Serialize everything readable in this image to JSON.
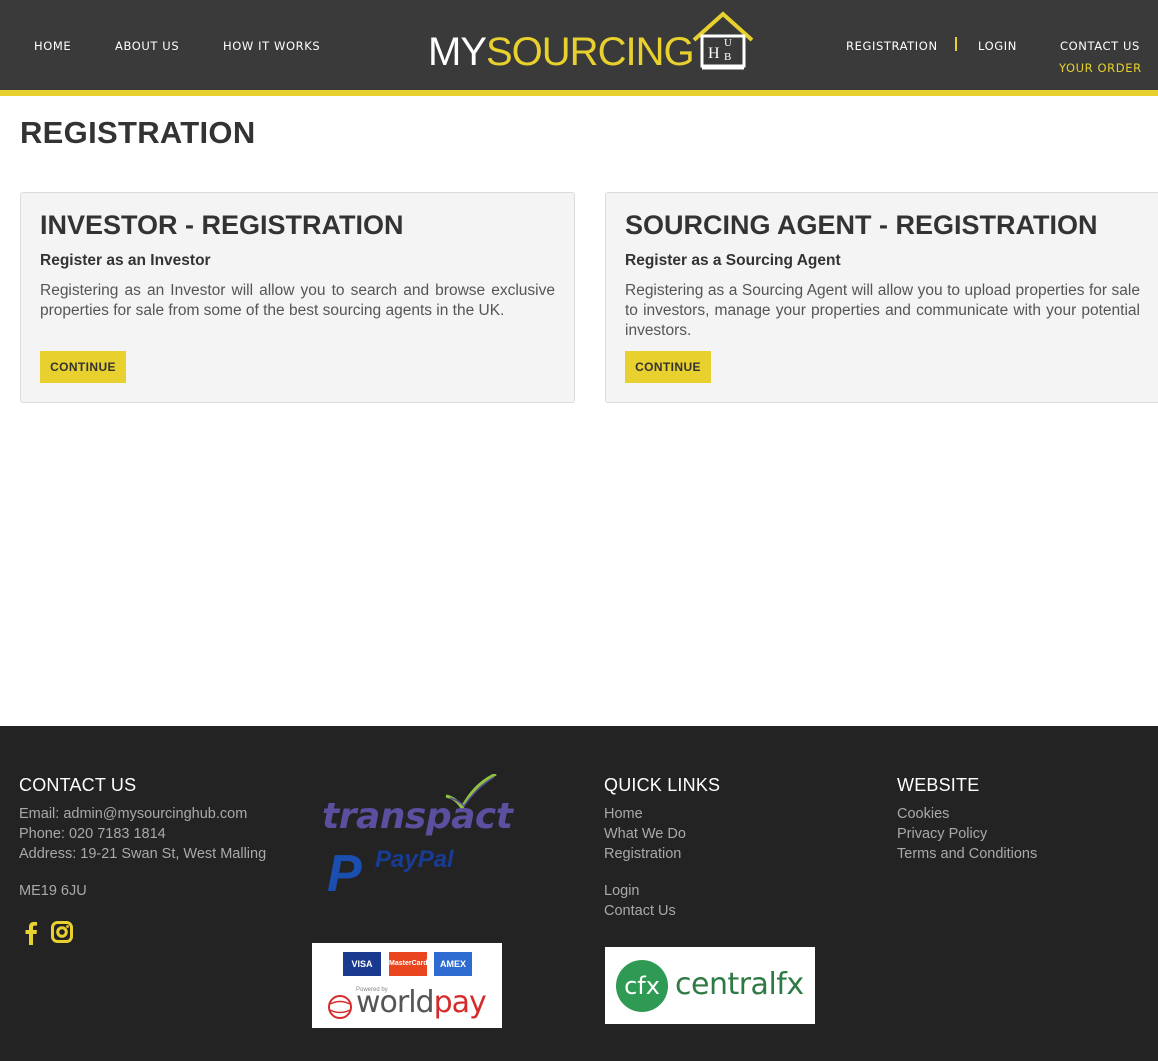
{
  "header": {
    "nav_left": [
      "HOME",
      "ABOUT US",
      "HOW IT WORKS"
    ],
    "nav_right": [
      "REGISTRATION",
      "LOGIN",
      "CONTACT US"
    ],
    "your_order": "YOUR ORDER",
    "logo": {
      "my": "MY",
      "sourcing": "SOURCING",
      "hub": "HUB"
    },
    "accent_color": "#e8d02e",
    "bg_color": "#393a39"
  },
  "page": {
    "title": "REGISTRATION"
  },
  "cards": [
    {
      "title": "INVESTOR - REGISTRATION",
      "subtitle": "Register as an Investor",
      "text": "Registering as an Investor will allow you to search and browse exclusive properties for sale from some of the best sourcing agents in the UK.",
      "button": "CONTINUE"
    },
    {
      "title": "SOURCING AGENT - REGISTRATION",
      "subtitle": "Register as a Sourcing Agent",
      "text": "Registering as a Sourcing Agent will allow you to upload properties for sale to investors, manage your properties and communicate with your potential investors.",
      "button": "CONTINUE"
    }
  ],
  "footer": {
    "contact": {
      "heading": "CONTACT US",
      "email": "Email: admin@mysourcinghub.com",
      "phone": "Phone: 020 7183 1814",
      "address": "Address: 19-21 Swan St, West Malling",
      "postcode": "ME19 6JU"
    },
    "social_icons": [
      "facebook-icon",
      "instagram-icon"
    ],
    "partners": {
      "transpact": "transpact",
      "paypal": "PayPal",
      "cards": [
        "VISA",
        "MasterCard",
        "AMEX"
      ],
      "powered_by": "Powered by",
      "worldpay_world": "world",
      "worldpay_pay": "pay",
      "cfx": "cfx",
      "centralfx": "centralfx"
    },
    "quick_links": {
      "heading": "QUICK LINKS",
      "items": [
        "Home",
        "What We Do",
        "Registration",
        "Login",
        "Contact Us"
      ]
    },
    "website": {
      "heading": "WEBSITE",
      "items": [
        "Cookies",
        "Privacy Policy",
        "Terms and Conditions"
      ]
    }
  }
}
